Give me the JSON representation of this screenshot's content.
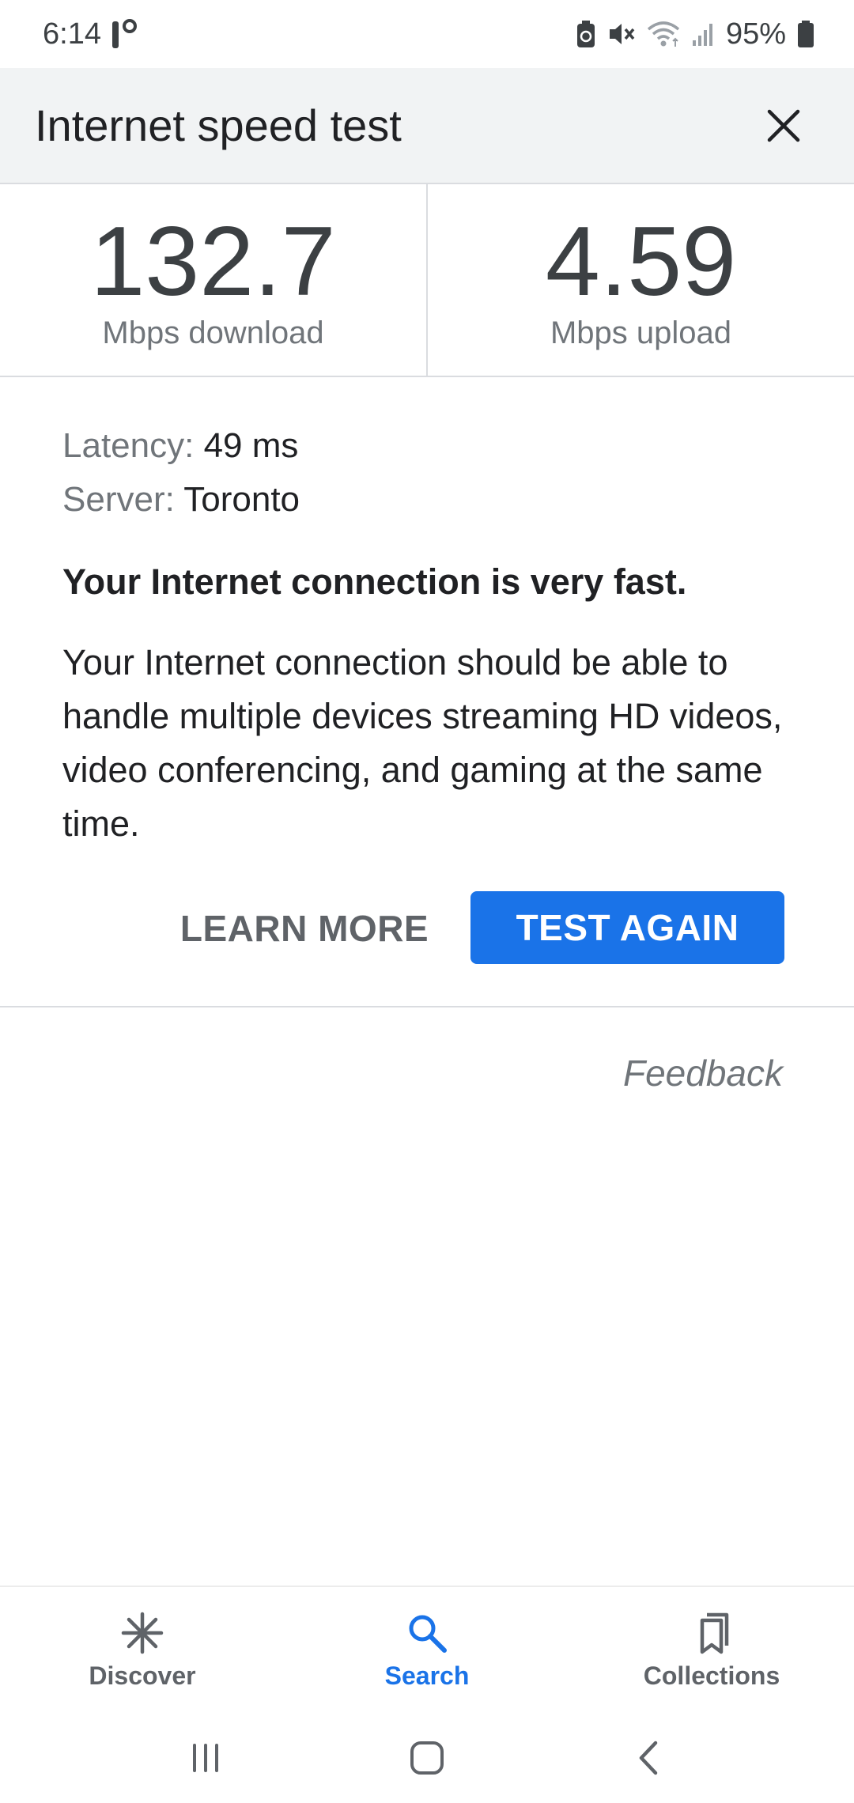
{
  "status_bar": {
    "time": "6:14",
    "battery": "95%",
    "icons": [
      "alert-temp-icon",
      "battery-saver-icon",
      "mute-icon",
      "wifi-icon",
      "signal-icon",
      "battery-icon"
    ]
  },
  "header": {
    "title": "Internet speed test",
    "close_icon": "close-icon"
  },
  "results": {
    "download_value": "132.7",
    "download_label": "Mbps download",
    "upload_value": "4.59",
    "upload_label": "Mbps upload"
  },
  "details": {
    "latency_key": "Latency:",
    "latency_value": "49 ms",
    "server_key": "Server:",
    "server_value": "Toronto",
    "verdict": "Your Internet connection is very fast.",
    "description": "Your Internet connection should be able to handle multiple devices streaming HD videos, video conferencing, and gaming at the same time."
  },
  "actions": {
    "learn_more": "LEARN MORE",
    "test_again": "TEST AGAIN",
    "feedback": "Feedback"
  },
  "bottom_nav": {
    "items": [
      {
        "label": "Discover",
        "icon": "asterisk-icon",
        "active": false
      },
      {
        "label": "Search",
        "icon": "search-icon",
        "active": true
      },
      {
        "label": "Collections",
        "icon": "bookmarks-icon",
        "active": false
      }
    ]
  },
  "system_nav": {
    "icons": [
      "recent-apps-icon",
      "home-icon",
      "back-icon"
    ]
  },
  "colors": {
    "accent": "#1a73e8",
    "header_bg": "#f1f3f4",
    "muted_text": "#70757a"
  }
}
